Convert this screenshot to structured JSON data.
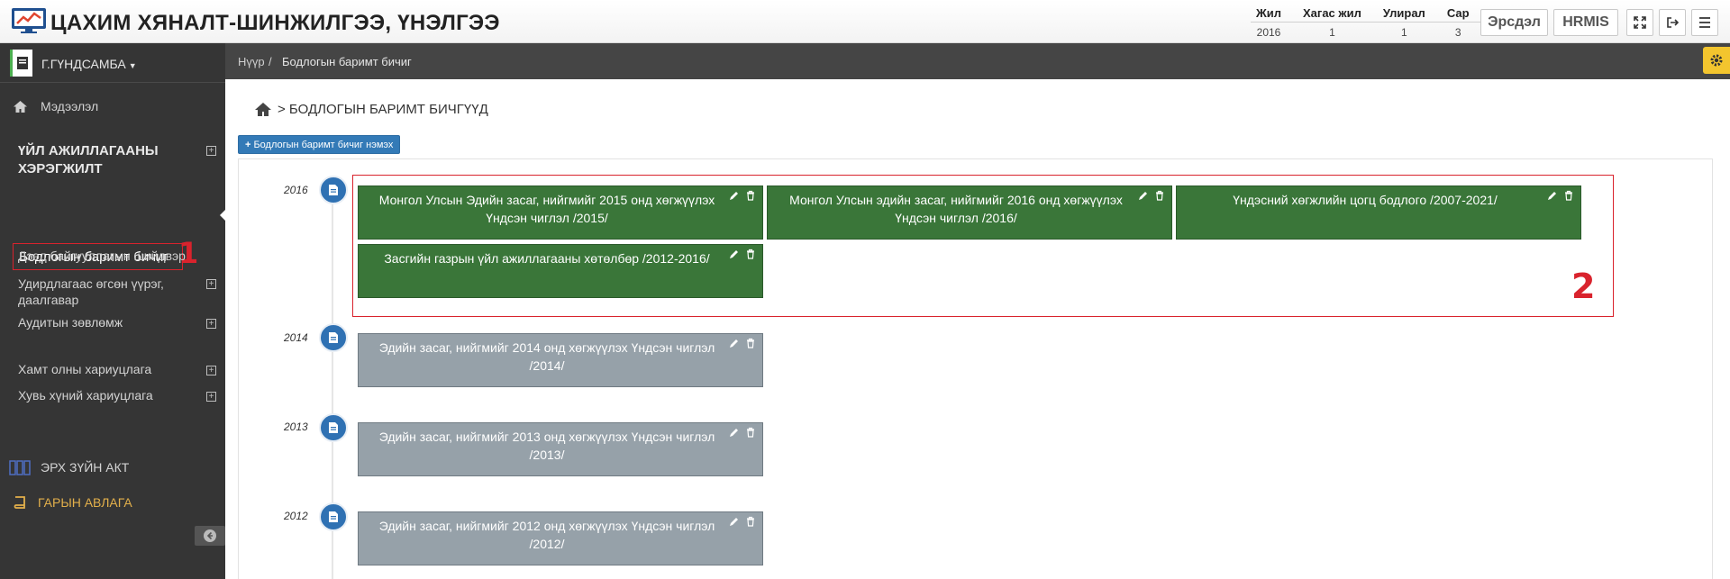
{
  "app": {
    "title": "ЦАХИМ ХЯНАЛТ-ШИНЖИЛГЭЭ, ҮНЭЛГЭЭ"
  },
  "period": {
    "headers": [
      "Жил",
      "Хагас жил",
      "Улирал",
      "Сар"
    ],
    "values": [
      "2016",
      "1",
      "1",
      "3"
    ]
  },
  "toolbar": {
    "ersdel": "Эрсдэл",
    "hrmis": "HRMIS"
  },
  "user": {
    "name": "Г.ГҮНДСАМБА"
  },
  "sidebar": {
    "info": "Мэдээлэл",
    "section": "ҮЙЛ АЖИЛЛАГААНЫ ХЭРЭГЖИЛТ",
    "active": "Бодлогын баримт бичиг",
    "items": [
      "Дээд байгууллагын шийдвэр",
      "Удирдлагаас өгсөн үүрэг, даалгавар",
      "Аудитын зөвлөмж",
      "Хамт олны хариуцлага",
      "Хувь хүний хариуцлага"
    ],
    "law": "ЭРХ ЗҮЙН АКТ",
    "guide": "ГАРЫН АВЛАГА"
  },
  "annotations": {
    "one": "1",
    "two": "2"
  },
  "breadcrumb": {
    "home": "Нүүр",
    "sep": "/",
    "current": "Бодлогын баримт бичиг"
  },
  "page": {
    "heading": "> БОДЛОГЫН БАРИМТ БИЧГҮҮД",
    "add_button": "Бодлогын баримт бичиг нэмэх"
  },
  "timeline": {
    "y2016": {
      "year": "2016",
      "docs": [
        "Монгол Улсын Эдийн засаг, нийгмийг 2015 онд хөгжүүлэх Үндсэн чиглэл /2015/",
        "Монгол Улсын эдийн засаг, нийгмийг 2016 онд хөгжүүлэх Үндсэн чиглэл /2016/",
        "Үндэсний хөгжлийн цогц бодлого /2007-2021/",
        "Засгийн газрын үйл ажиллагааны хөтөлбөр /2012-2016/"
      ]
    },
    "y2014": {
      "year": "2014",
      "doc": "Эдийн засаг, нийгмийг 2014 онд хөгжүүлэх Үндсэн чиглэл /2014/"
    },
    "y2013": {
      "year": "2013",
      "doc": "Эдийн засаг, нийгмийг 2013 онд хөгжүүлэх Үндсэн чиглэл /2013/"
    },
    "y2012": {
      "year": "2012",
      "doc": "Эдийн засаг, нийгмийг 2012 онд хөгжүүлэх Үндсэн чиглэл /2012/"
    }
  },
  "colors": {
    "card_active": "#3a7639",
    "card_inactive": "#96a1a9",
    "timeline_icon": "#2f71b3",
    "annotation": "#d9232d"
  }
}
